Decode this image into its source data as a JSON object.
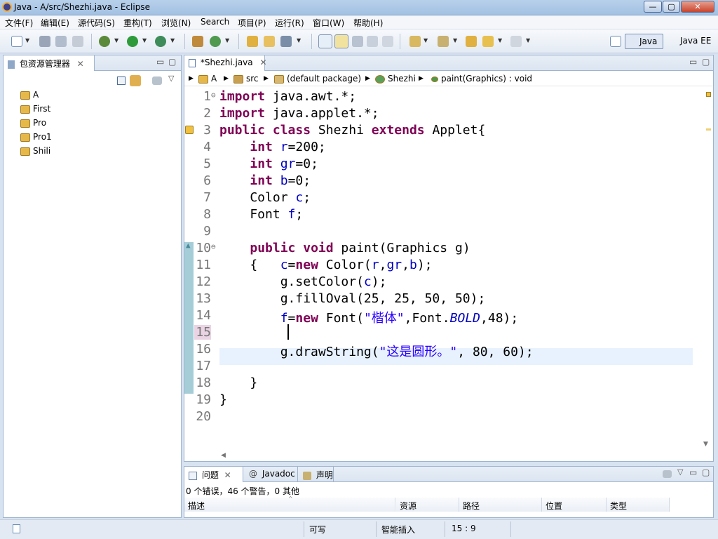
{
  "window": {
    "title": "Java - A/src/Shezhi.java - Eclipse",
    "min": "—",
    "max": "▢",
    "close": "✕"
  },
  "menu": [
    "文件(F)",
    "编辑(E)",
    "源代码(S)",
    "重构(T)",
    "浏览(N)",
    "Search",
    "项目(P)",
    "运行(R)",
    "窗口(W)",
    "帮助(H)"
  ],
  "toolbar": {
    "perspectives": [
      "Java",
      "Java EE"
    ]
  },
  "package_explorer": {
    "tab_label": "包资源管理器",
    "projects": [
      "A",
      "First",
      "Pro",
      "Pro1",
      "Shili"
    ]
  },
  "editor": {
    "tab_label": "*Shezhi.java",
    "breadcrumb": [
      "A",
      "src",
      "(default package)",
      "Shezhi",
      "paint(Graphics) : void"
    ],
    "line_numbers": [
      "1",
      "2",
      "3",
      "4",
      "5",
      "6",
      "7",
      "8",
      "9",
      "10",
      "11",
      "12",
      "13",
      "14",
      "15",
      "16",
      "17",
      "18",
      "19",
      "20"
    ],
    "lines": [
      "import java.awt.*;",
      "import java.applet.*;",
      "public class Shezhi extends Applet{",
      "    int r=200;",
      "    int gr=0;",
      "    int b=0;",
      "    Color c;",
      "    Font f;",
      "",
      "    public void paint(Graphics g)",
      "    {   c=new Color(r,gr,b);",
      "        g.setColor(c);",
      "        g.fillOval(25, 25, 50, 50);",
      "        f=new Font(\"楷体\",Font.BOLD,48);",
      "",
      "        g.drawString(\"这是圆形。\", 80, 60);",
      "",
      "    }",
      "}",
      ""
    ],
    "current_line": 15
  },
  "bottom_panel": {
    "tabs": [
      "问题",
      "Javadoc",
      "声明"
    ],
    "summary": "0 个错误，46 个警告，0 其他",
    "columns": [
      "描述",
      "资源",
      "路径",
      "位置",
      "类型"
    ]
  },
  "status": {
    "writable": "可写",
    "insert_mode": "智能插入",
    "position": "15 : 9"
  }
}
